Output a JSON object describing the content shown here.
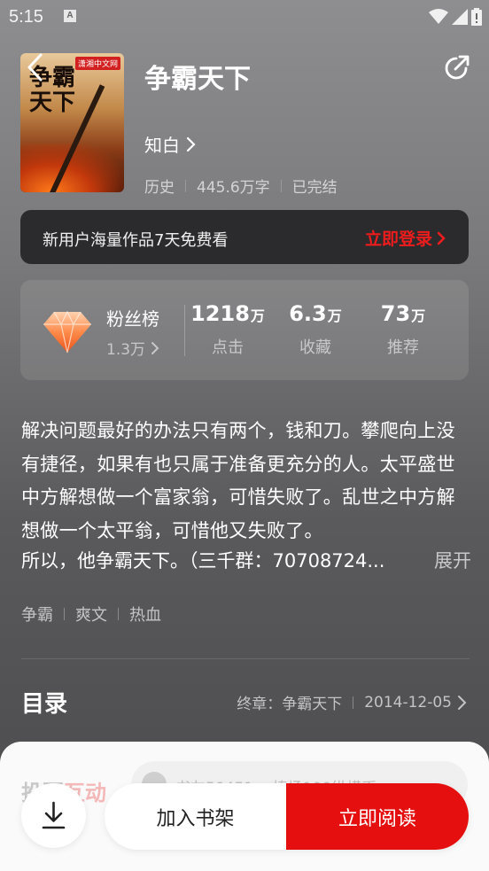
{
  "status_bar": {
    "time": "5:15",
    "notification_icon": "A"
  },
  "book": {
    "cover_title": "争霸天下",
    "cover_brand": "潇湘中文网",
    "title": "争霸天下",
    "author": "知白",
    "category": "历史",
    "word_count": "445.6万字",
    "status": "已完结"
  },
  "login_banner": {
    "text": "新用户海量作品7天免费看",
    "button": "立即登录"
  },
  "stats": {
    "fans_label": "粉丝榜",
    "fans_count": "1.3万",
    "clicks_value": "1218",
    "clicks_unit": "万",
    "clicks_label": "点击",
    "favorites_value": "6.3",
    "favorites_unit": "万",
    "favorites_label": "收藏",
    "recommend_value": "73",
    "recommend_unit": "万",
    "recommend_label": "推荐"
  },
  "description": {
    "text": "解决问题最好的办法只有两个，钱和刀。攀爬向上没有捷径，如果有也只属于准备更充分的人。太平盛世中方解想做一个富家翁，可惜失败了。乱世之中方解想做一个太平翁，可惜他又失败了。",
    "last_line": "所以，他争霸天下。（三千群：70708724...",
    "expand": "展开"
  },
  "tags": [
    "争霸",
    "爽文",
    "热血"
  ],
  "toc": {
    "title": "目录",
    "latest_label": "终章：争霸天下",
    "date": "2014-12-05"
  },
  "bottom": {
    "interact_title_a": "投票",
    "interact_title_b": "互动",
    "interact_text": "书友50451... 捧场100纵横币",
    "add_shelf": "加入书架",
    "read_now": "立即阅读"
  },
  "colors": {
    "accent": "#e50f0f",
    "banner_bg": "#2b2b2d",
    "login_text": "#ee1c1c"
  },
  "icons": [
    "back-icon",
    "share-icon",
    "chevron-right-icon",
    "gem-icon",
    "download-icon",
    "wifi-icon",
    "signal-icon",
    "battery-icon"
  ]
}
